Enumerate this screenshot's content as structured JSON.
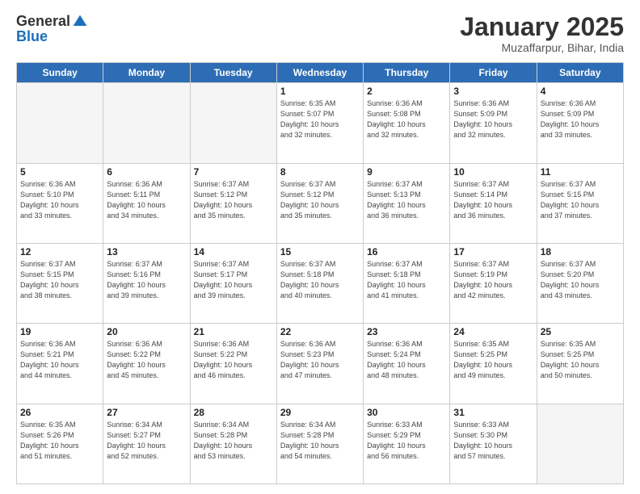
{
  "header": {
    "logo_general": "General",
    "logo_blue": "Blue",
    "month_title": "January 2025",
    "location": "Muzaffarpur, Bihar, India"
  },
  "days_of_week": [
    "Sunday",
    "Monday",
    "Tuesday",
    "Wednesday",
    "Thursday",
    "Friday",
    "Saturday"
  ],
  "weeks": [
    [
      {
        "day": "",
        "info": ""
      },
      {
        "day": "",
        "info": ""
      },
      {
        "day": "",
        "info": ""
      },
      {
        "day": "1",
        "info": "Sunrise: 6:35 AM\nSunset: 5:07 PM\nDaylight: 10 hours\nand 32 minutes."
      },
      {
        "day": "2",
        "info": "Sunrise: 6:36 AM\nSunset: 5:08 PM\nDaylight: 10 hours\nand 32 minutes."
      },
      {
        "day": "3",
        "info": "Sunrise: 6:36 AM\nSunset: 5:09 PM\nDaylight: 10 hours\nand 32 minutes."
      },
      {
        "day": "4",
        "info": "Sunrise: 6:36 AM\nSunset: 5:09 PM\nDaylight: 10 hours\nand 33 minutes."
      }
    ],
    [
      {
        "day": "5",
        "info": "Sunrise: 6:36 AM\nSunset: 5:10 PM\nDaylight: 10 hours\nand 33 minutes."
      },
      {
        "day": "6",
        "info": "Sunrise: 6:36 AM\nSunset: 5:11 PM\nDaylight: 10 hours\nand 34 minutes."
      },
      {
        "day": "7",
        "info": "Sunrise: 6:37 AM\nSunset: 5:12 PM\nDaylight: 10 hours\nand 35 minutes."
      },
      {
        "day": "8",
        "info": "Sunrise: 6:37 AM\nSunset: 5:12 PM\nDaylight: 10 hours\nand 35 minutes."
      },
      {
        "day": "9",
        "info": "Sunrise: 6:37 AM\nSunset: 5:13 PM\nDaylight: 10 hours\nand 36 minutes."
      },
      {
        "day": "10",
        "info": "Sunrise: 6:37 AM\nSunset: 5:14 PM\nDaylight: 10 hours\nand 36 minutes."
      },
      {
        "day": "11",
        "info": "Sunrise: 6:37 AM\nSunset: 5:15 PM\nDaylight: 10 hours\nand 37 minutes."
      }
    ],
    [
      {
        "day": "12",
        "info": "Sunrise: 6:37 AM\nSunset: 5:15 PM\nDaylight: 10 hours\nand 38 minutes."
      },
      {
        "day": "13",
        "info": "Sunrise: 6:37 AM\nSunset: 5:16 PM\nDaylight: 10 hours\nand 39 minutes."
      },
      {
        "day": "14",
        "info": "Sunrise: 6:37 AM\nSunset: 5:17 PM\nDaylight: 10 hours\nand 39 minutes."
      },
      {
        "day": "15",
        "info": "Sunrise: 6:37 AM\nSunset: 5:18 PM\nDaylight: 10 hours\nand 40 minutes."
      },
      {
        "day": "16",
        "info": "Sunrise: 6:37 AM\nSunset: 5:18 PM\nDaylight: 10 hours\nand 41 minutes."
      },
      {
        "day": "17",
        "info": "Sunrise: 6:37 AM\nSunset: 5:19 PM\nDaylight: 10 hours\nand 42 minutes."
      },
      {
        "day": "18",
        "info": "Sunrise: 6:37 AM\nSunset: 5:20 PM\nDaylight: 10 hours\nand 43 minutes."
      }
    ],
    [
      {
        "day": "19",
        "info": "Sunrise: 6:36 AM\nSunset: 5:21 PM\nDaylight: 10 hours\nand 44 minutes."
      },
      {
        "day": "20",
        "info": "Sunrise: 6:36 AM\nSunset: 5:22 PM\nDaylight: 10 hours\nand 45 minutes."
      },
      {
        "day": "21",
        "info": "Sunrise: 6:36 AM\nSunset: 5:22 PM\nDaylight: 10 hours\nand 46 minutes."
      },
      {
        "day": "22",
        "info": "Sunrise: 6:36 AM\nSunset: 5:23 PM\nDaylight: 10 hours\nand 47 minutes."
      },
      {
        "day": "23",
        "info": "Sunrise: 6:36 AM\nSunset: 5:24 PM\nDaylight: 10 hours\nand 48 minutes."
      },
      {
        "day": "24",
        "info": "Sunrise: 6:35 AM\nSunset: 5:25 PM\nDaylight: 10 hours\nand 49 minutes."
      },
      {
        "day": "25",
        "info": "Sunrise: 6:35 AM\nSunset: 5:25 PM\nDaylight: 10 hours\nand 50 minutes."
      }
    ],
    [
      {
        "day": "26",
        "info": "Sunrise: 6:35 AM\nSunset: 5:26 PM\nDaylight: 10 hours\nand 51 minutes."
      },
      {
        "day": "27",
        "info": "Sunrise: 6:34 AM\nSunset: 5:27 PM\nDaylight: 10 hours\nand 52 minutes."
      },
      {
        "day": "28",
        "info": "Sunrise: 6:34 AM\nSunset: 5:28 PM\nDaylight: 10 hours\nand 53 minutes."
      },
      {
        "day": "29",
        "info": "Sunrise: 6:34 AM\nSunset: 5:28 PM\nDaylight: 10 hours\nand 54 minutes."
      },
      {
        "day": "30",
        "info": "Sunrise: 6:33 AM\nSunset: 5:29 PM\nDaylight: 10 hours\nand 56 minutes."
      },
      {
        "day": "31",
        "info": "Sunrise: 6:33 AM\nSunset: 5:30 PM\nDaylight: 10 hours\nand 57 minutes."
      },
      {
        "day": "",
        "info": ""
      }
    ]
  ]
}
